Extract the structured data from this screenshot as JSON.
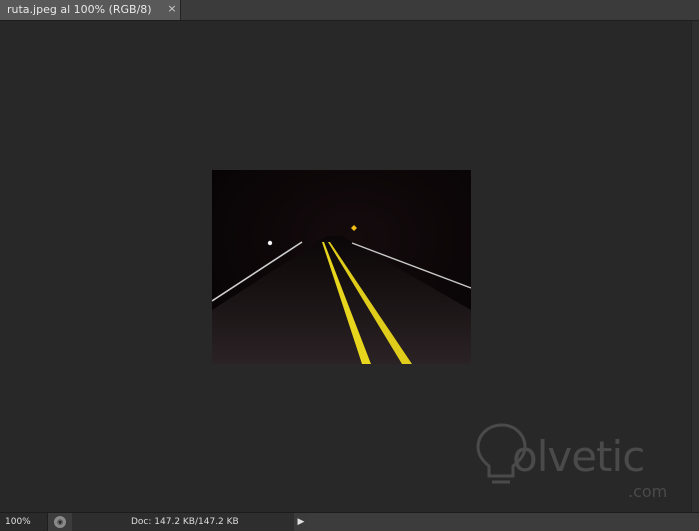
{
  "document_tab": {
    "title": "ruta.jpeg al 100% (RGB/8)",
    "close_glyph": "×"
  },
  "canvas": {
    "image_description_icon": "night-road-photo",
    "road_line_color": "#e8d51e",
    "edge_line_color": "#d9d9d9"
  },
  "watermark": {
    "brand": "olvetic",
    "suffix": ".com",
    "logo_icon": "lightbulb-icon",
    "color": "#4a4a4a"
  },
  "statusbar": {
    "zoom": "100%",
    "doc_info": "Doc: 147.2 KB/147.2 KB",
    "menu_arrow": "▶"
  }
}
